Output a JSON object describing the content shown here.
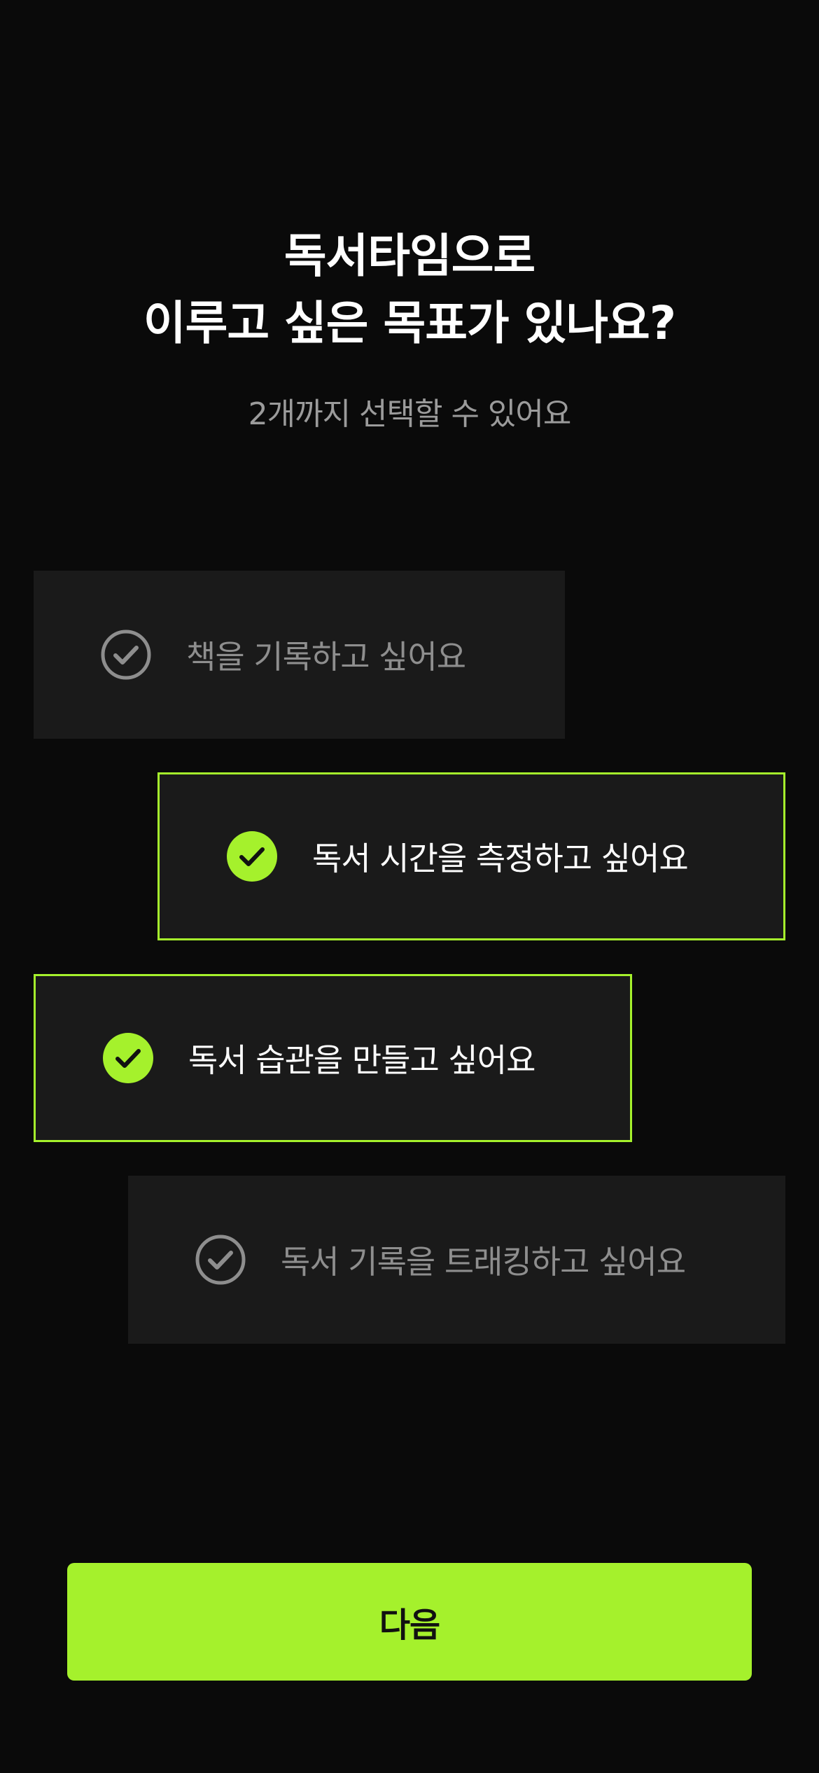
{
  "header": {
    "title_line1": "독서타임으로",
    "title_line2": "이루고 싶은 목표가 있나요?",
    "subtitle": "2개까지 선택할 수 있어요"
  },
  "options": [
    {
      "label": "책을 기록하고 싶어요",
      "selected": false,
      "icon": "check-circle-outline-icon"
    },
    {
      "label": "독서 시간을 측정하고 싶어요",
      "selected": true,
      "icon": "check-circle-filled-icon"
    },
    {
      "label": "독서 습관을 만들고 싶어요",
      "selected": true,
      "icon": "check-circle-filled-icon"
    },
    {
      "label": "독서 기록을 트래킹하고 싶어요",
      "selected": false,
      "icon": "check-circle-outline-icon"
    }
  ],
  "footer": {
    "next_label": "다음"
  },
  "colors": {
    "background": "#0a0a0a",
    "card": "#1a1a1a",
    "accent": "#a5f12c",
    "muted_text": "#8e8e8e"
  }
}
